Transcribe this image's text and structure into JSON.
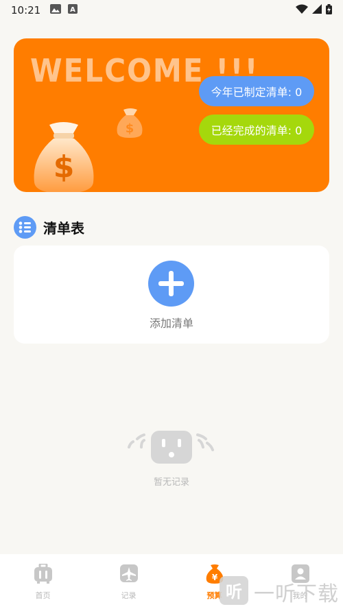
{
  "status_bar": {
    "time": "10:21",
    "icons": [
      "image-icon",
      "a-badge-icon",
      "wifi-icon",
      "signal-icon",
      "battery-icon"
    ]
  },
  "banner": {
    "welcome_text": "WELCOME !!!",
    "planned_lists_label": "今年已制定清单: 0",
    "completed_lists_label": "已经完成的清单: 0",
    "colors": {
      "background": "#ff7d00",
      "pill_blue": "#5e9bf5",
      "pill_green": "#a5d80c"
    }
  },
  "list_section": {
    "title": "清单表",
    "add_label": "添加清单"
  },
  "empty_state": {
    "text": "暂无记录"
  },
  "bottom_nav": {
    "items": [
      {
        "label": "首页",
        "icon": "luggage-icon",
        "active": false
      },
      {
        "label": "记录",
        "icon": "plane-icon",
        "active": false
      },
      {
        "label": "预算",
        "icon": "money-bag-icon",
        "active": true
      },
      {
        "label": "我的",
        "icon": "person-icon",
        "active": false
      }
    ],
    "active_color": "#ff7d00"
  },
  "watermark": {
    "text": "一听下载"
  }
}
